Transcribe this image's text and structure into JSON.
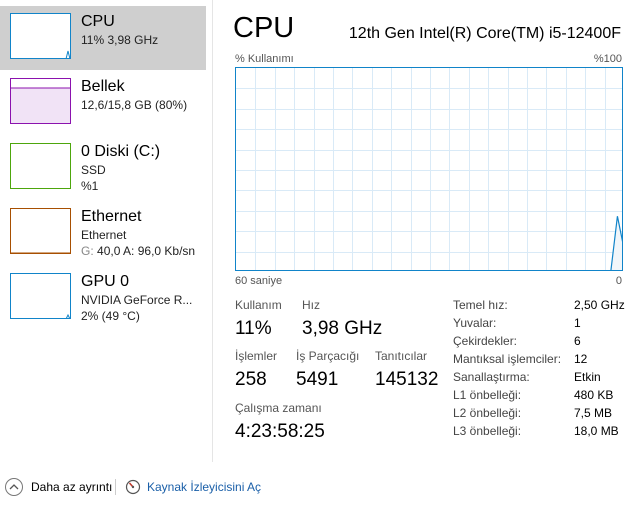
{
  "sidebar": {
    "items": [
      {
        "title": "CPU",
        "lines": [
          "11% 3,98 GHz"
        ],
        "color": "#1184c9",
        "selected": true
      },
      {
        "title": "Bellek",
        "lines": [
          "12,6/15,8 GB (80%)"
        ],
        "color": "#8b12ae",
        "selected": false
      },
      {
        "title": "0 Diski (C:)",
        "lines": [
          "SSD",
          "%1"
        ],
        "color": "#4da60c",
        "selected": false
      },
      {
        "title": "Ethernet",
        "lines": [
          "Ethernet"
        ],
        "line3_prefix": "G:",
        "line3": "40,0  A: 96,0 Kb/sn",
        "color": "#a74f01",
        "selected": false
      },
      {
        "title": "GPU 0",
        "lines": [
          "NVIDIA GeForce R...",
          "2% (49 °C)"
        ],
        "color": "#1184c9",
        "selected": false
      }
    ]
  },
  "main": {
    "title": "CPU",
    "processor": "12th Gen Intel(R) Core(TM) i5-12400F",
    "util_label": "% Kullanımı",
    "util_max": "%100",
    "axis_left": "60 saniye",
    "axis_right": "0",
    "graph_color": "#1184c9",
    "graph_points_pct": [
      0,
      0,
      0,
      0,
      0,
      0,
      0,
      0,
      0,
      0,
      0,
      0,
      0,
      0,
      0,
      0,
      0,
      0,
      0,
      0,
      0,
      0,
      0,
      0,
      0,
      0,
      0,
      0,
      0,
      0,
      0,
      0,
      0,
      0,
      0,
      0,
      0,
      0,
      0,
      0,
      0,
      0,
      0,
      0,
      0,
      0,
      0,
      0,
      0,
      0,
      0,
      0,
      0,
      0,
      0,
      0,
      0,
      0,
      27,
      11
    ]
  },
  "stats": {
    "usage_label": "Kullanım",
    "usage_value": "11%",
    "speed_label": "Hız",
    "speed_value": "3,98 GHz",
    "processes_label": "İşlemler",
    "processes_value": "258",
    "threads_label": "İş Parçacığı",
    "threads_value": "5491",
    "handles_label": "Tanıtıcılar",
    "handles_value": "145132",
    "uptime_label": "Çalışma zamanı",
    "uptime_value": "4:23:58:25"
  },
  "specs": [
    {
      "label": "Temel hız:",
      "value": "2,50 GHz"
    },
    {
      "label": "Yuvalar:",
      "value": "1"
    },
    {
      "label": "Çekirdekler:",
      "value": "6"
    },
    {
      "label": "Mantıksal işlemciler:",
      "value": "12"
    },
    {
      "label": "Sanallaştırma:",
      "value": "Etkin"
    },
    {
      "label": "L1 önbelleği:",
      "value": "480 KB"
    },
    {
      "label": "L2 önbelleği:",
      "value": "7,5 MB"
    },
    {
      "label": "L3 önbelleği:",
      "value": "18,0 MB"
    }
  ],
  "footer": {
    "fewer_details": "Daha az ayrıntı",
    "resource_monitor": "Kaynak İzleyicisini Aç"
  }
}
